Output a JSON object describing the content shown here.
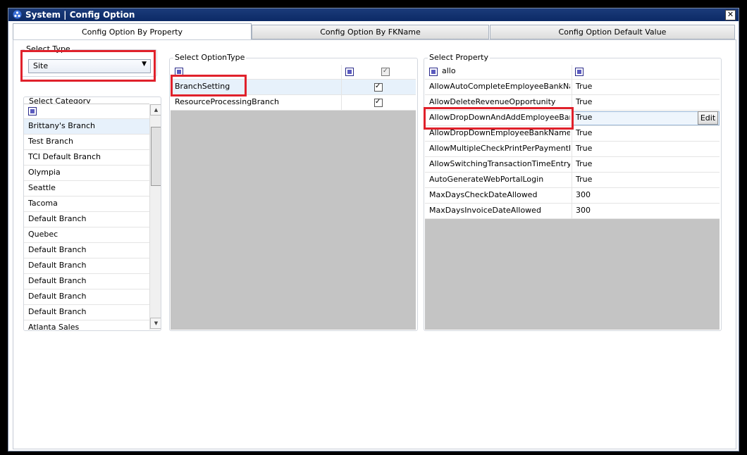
{
  "window": {
    "title": "System | Config Option",
    "close_label": "✕"
  },
  "tabs": [
    {
      "label": "Config Option By Property"
    },
    {
      "label": "Config Option By FKName"
    },
    {
      "label": "Config Option Default Value"
    }
  ],
  "select_type": {
    "label": "Select Type",
    "value": "Site"
  },
  "select_category": {
    "label": "Select Category",
    "items": [
      "Brittany's Branch",
      "Test Branch",
      "TCI Default Branch",
      "Olympia",
      "Seattle",
      "Tacoma",
      "Default Branch",
      "Quebec",
      "Default Branch",
      "Default Branch",
      "Default Branch",
      "Default Branch",
      "Default Branch",
      "Atlanta Sales"
    ]
  },
  "select_option_type": {
    "label": "Select OptionType",
    "rows": [
      {
        "name": "BranchSetting"
      },
      {
        "name": "ResourceProcessingBranch"
      }
    ]
  },
  "select_property": {
    "label": "Select Property",
    "filter_value": "allo",
    "edit_label": "Edit",
    "rows": [
      {
        "name": "AllowAutoCompleteEmployeeBankNam",
        "value": "True"
      },
      {
        "name": "AllowDeleteRevenueOpportunity",
        "value": "True"
      },
      {
        "name": "AllowDropDownAndAddEmployeeBank",
        "value": "True"
      },
      {
        "name": "AllowDropDownEmployeeBankName",
        "value": "True"
      },
      {
        "name": "AllowMultipleCheckPrintPerPaymentBat",
        "value": "True"
      },
      {
        "name": "AllowSwitchingTransactionTimeEntryBa",
        "value": "True"
      },
      {
        "name": "AutoGenerateWebPortalLogin",
        "value": "True"
      },
      {
        "name": "MaxDaysCheckDateAllowed",
        "value": "300"
      },
      {
        "name": "MaxDaysInvoiceDateAllowed",
        "value": "300"
      }
    ]
  },
  "colors": {
    "highlight": "#e0212b",
    "titlebar": "#0c2a66",
    "grid_empty": "#c4c4c4"
  }
}
